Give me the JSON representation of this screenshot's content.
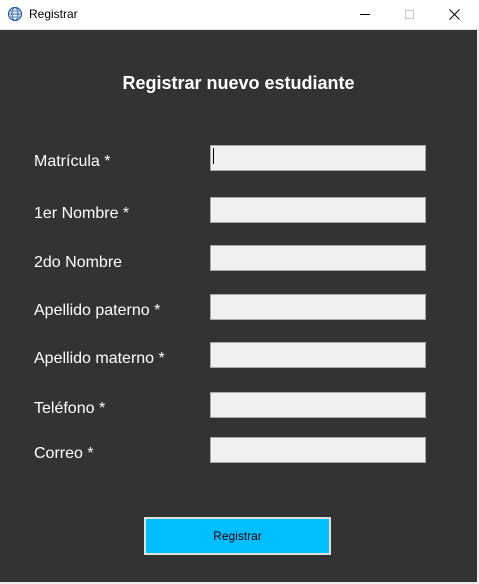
{
  "window": {
    "title": "Registrar",
    "icon": "app-globe-icon"
  },
  "form": {
    "heading": "Registrar nuevo estudiante",
    "fields": [
      {
        "label": "Matrícula *",
        "value": ""
      },
      {
        "label": "1er Nombre *",
        "value": ""
      },
      {
        "label": "2do Nombre",
        "value": ""
      },
      {
        "label": "Apellido paterno *",
        "value": ""
      },
      {
        "label": "Apellido materno *",
        "value": ""
      },
      {
        "label": "Teléfono *",
        "value": ""
      },
      {
        "label": "Correo *",
        "value": ""
      }
    ],
    "submit_label": "Registrar"
  },
  "colors": {
    "background": "#333333",
    "button": "#00bfff",
    "field": "#f0f0f0"
  }
}
